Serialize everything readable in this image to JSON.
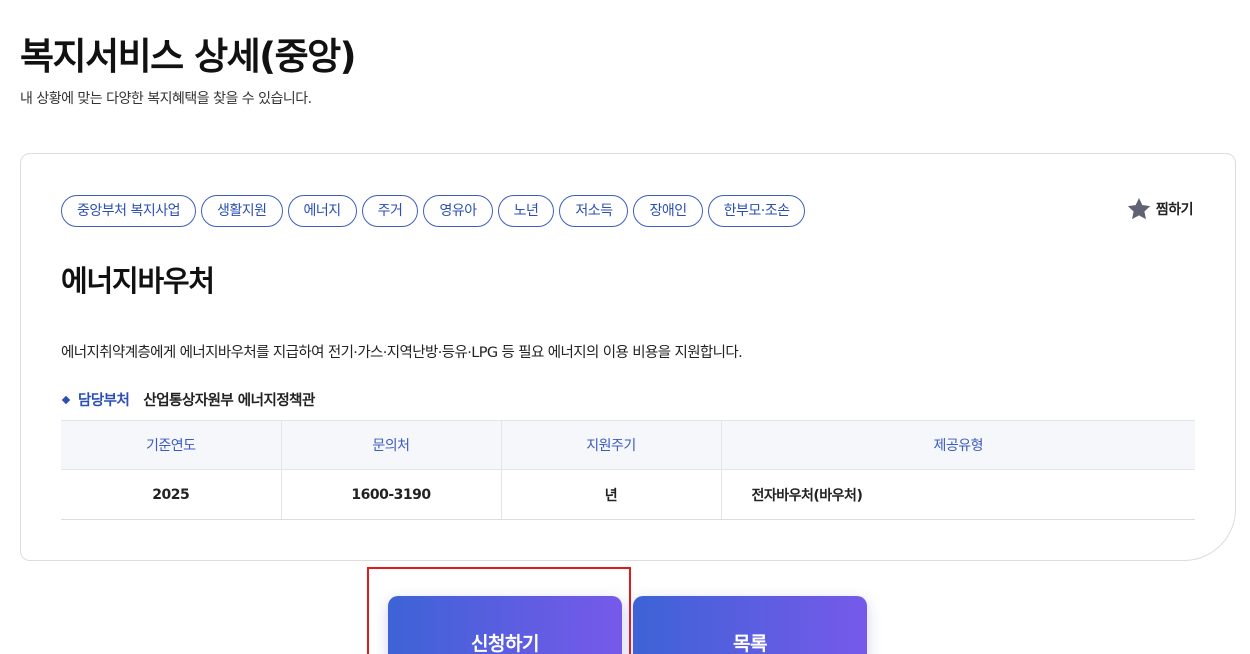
{
  "header": {
    "title": "복지서비스 상세(중앙)",
    "subtitle": "내 상황에 맞는 다양한 복지혜택을 찾을 수 있습니다."
  },
  "card": {
    "tags": [
      "중앙부처 복지사업",
      "생활지원",
      "에너지",
      "주거",
      "영유아",
      "노년",
      "저소득",
      "장애인",
      "한부모·조손"
    ],
    "bookmark_label": "찜하기",
    "service_title": "에너지바우처",
    "description": "에너지취약계층에게 에너지바우처를 지급하여 전기·가스·지역난방·등유·LPG 등 필요 에너지의 이용 비용을 지원합니다.",
    "department": {
      "label": "담당부처",
      "value": "산업통상자원부 에너지정책관"
    },
    "table": {
      "headers": [
        "기준연도",
        "문의처",
        "지원주기",
        "제공유형"
      ],
      "row": [
        "2025",
        "1600-3190",
        "년",
        "전자바우처(바우처)"
      ]
    }
  },
  "actions": {
    "apply_label": "신청하기",
    "list_label": "목록"
  },
  "colors": {
    "accent": "#2b4fb5",
    "button_gradient_start": "#3d63d6",
    "button_gradient_end": "#7759ea",
    "highlight": "#e11b1b"
  }
}
